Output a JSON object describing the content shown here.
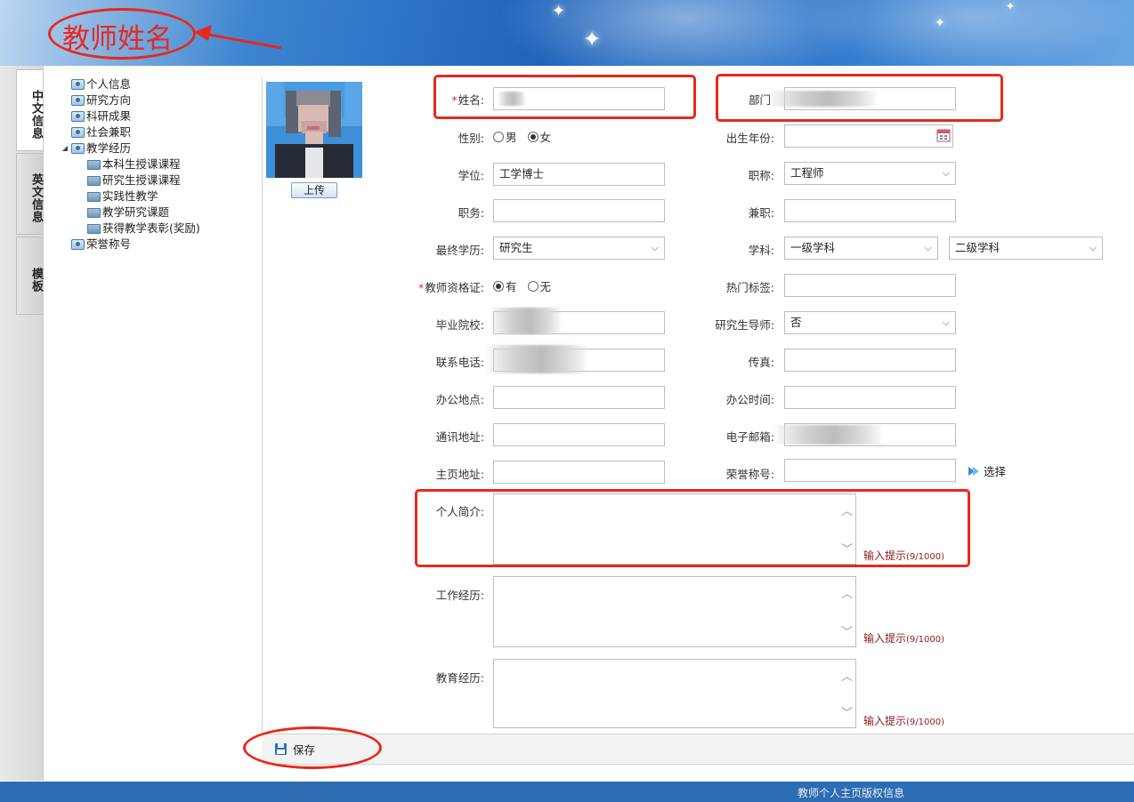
{
  "header": {
    "title": "教师姓名"
  },
  "tabs": [
    {
      "label": "中文信息",
      "active": true
    },
    {
      "label": "英文信息",
      "active": false
    },
    {
      "label": "模板",
      "active": false
    }
  ],
  "tree": {
    "items": [
      {
        "label": "个人信息",
        "level": 0,
        "type": "doc"
      },
      {
        "label": "研究方向",
        "level": 0,
        "type": "doc"
      },
      {
        "label": "科研成果",
        "level": 0,
        "type": "doc"
      },
      {
        "label": "社会兼职",
        "level": 0,
        "type": "doc"
      },
      {
        "label": "教学经历",
        "level": 0,
        "type": "doc",
        "expanded": true
      },
      {
        "label": "本科生授课课程",
        "level": 1,
        "type": "folder"
      },
      {
        "label": "研究生授课课程",
        "level": 1,
        "type": "folder"
      },
      {
        "label": "实践性教学",
        "level": 1,
        "type": "folder"
      },
      {
        "label": "教学研究课题",
        "level": 1,
        "type": "folder"
      },
      {
        "label": "获得教学表彰(奖励)",
        "level": 1,
        "type": "folder"
      },
      {
        "label": "荣誉称号",
        "level": 0,
        "type": "doc"
      }
    ]
  },
  "photo": {
    "upload_label": "上传"
  },
  "form": {
    "name_label": "姓名:",
    "dept_label": "部门",
    "gender_label": "性别:",
    "gender_male": "男",
    "gender_female": "女",
    "gender_selected": "女",
    "birth_label": "出生年份:",
    "degree_label": "学位:",
    "degree_value": "工学博士",
    "title_label": "职称:",
    "title_value": "工程师",
    "duty_label": "职务:",
    "parttime_label": "兼职:",
    "edu_label": "最终学历:",
    "edu_value": "研究生",
    "subject_label": "学科:",
    "subject1_value": "一级学科",
    "subject2_value": "二级学科",
    "cert_label": "教师资格证:",
    "cert_yes": "有",
    "cert_no": "无",
    "cert_selected": "有",
    "tags_label": "热门标签:",
    "school_label": "毕业院校:",
    "supervisor_label": "研究生导师:",
    "supervisor_value": "否",
    "phone_label": "联系电话:",
    "fax_label": "传真:",
    "office_label": "办公地点:",
    "hours_label": "办公时间:",
    "address_label": "通讯地址:",
    "email_label": "电子邮箱:",
    "homepage_label": "主页地址:",
    "honor_label": "荣誉称号:",
    "pick_label": "选择",
    "intro_label": "个人简介:",
    "work_label": "工作经历:",
    "education_label": "教育经历:",
    "hint_label": "输入提示",
    "hint_count": "(9/1000)"
  },
  "toolbar": {
    "save_label": "保存"
  },
  "footer": {
    "text": "教师个人主页版权信息"
  },
  "colors": {
    "annotation": "#e8281c",
    "header_blue": "#1f63bb",
    "footer_blue": "#2c6db4",
    "hint": "#8b1a1a"
  }
}
